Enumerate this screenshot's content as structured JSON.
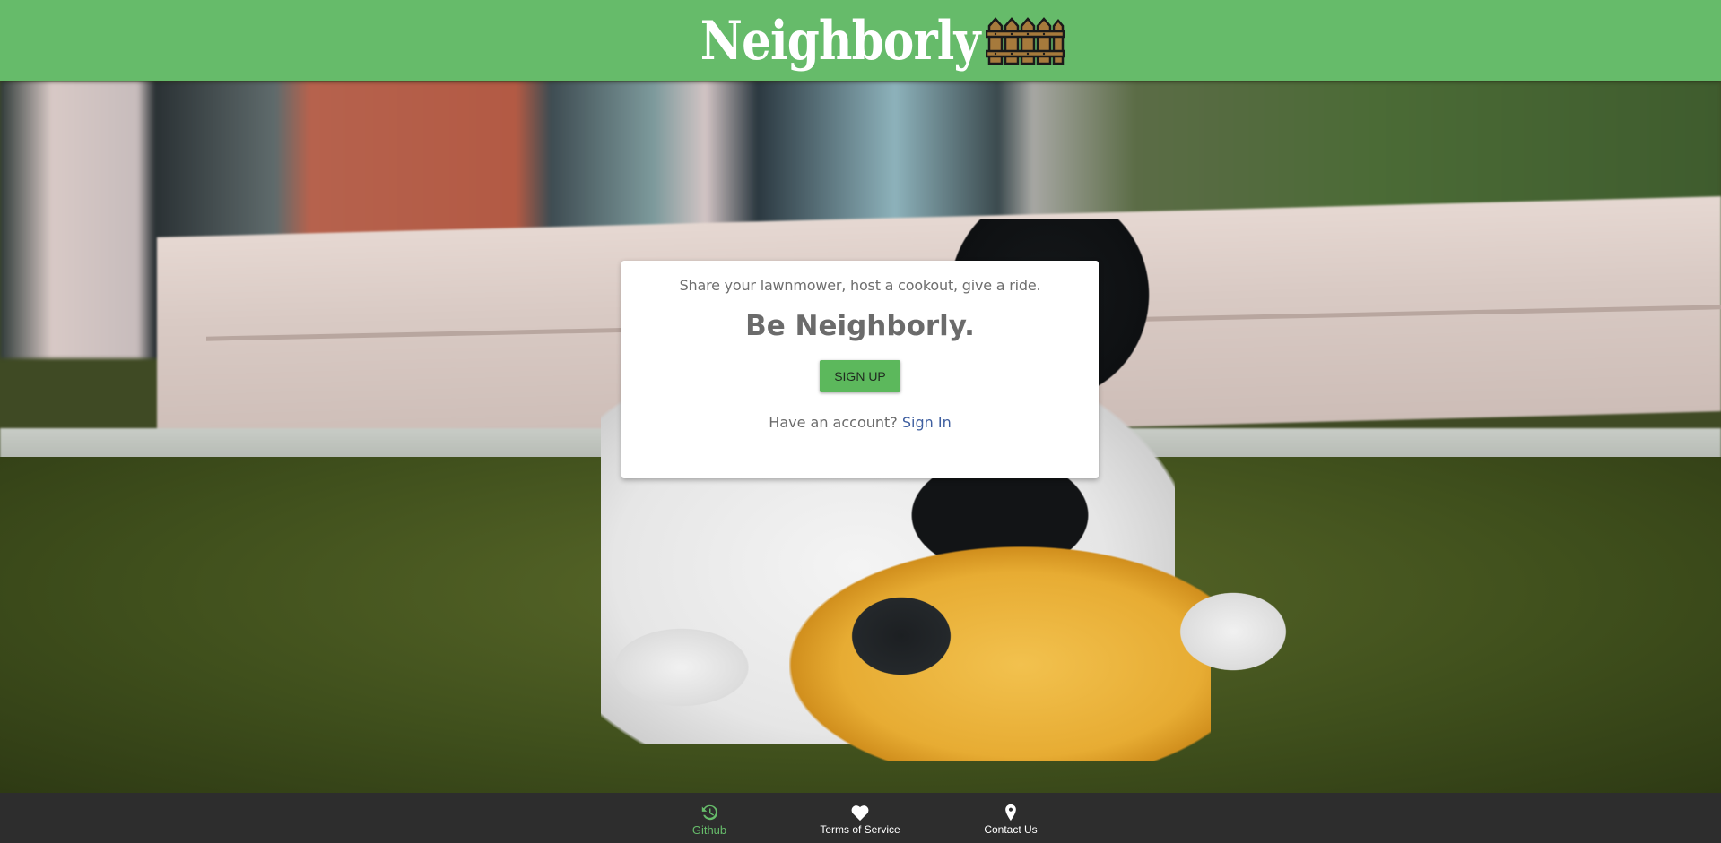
{
  "header": {
    "brand": "Neighborly",
    "logo_icon": "fence-icon",
    "background_color": "#66bb6a"
  },
  "card": {
    "tagline": "Share your lawnmower, host a cookout, give a ride.",
    "headline": "Be Neighborly.",
    "signup_label": "SIGN UP",
    "signin_prompt": "Have an account?",
    "signin_link": "Sign In",
    "button_color": "#5cb85c",
    "link_color": "#3f5fa0"
  },
  "footer": {
    "items": [
      {
        "label": "Github",
        "icon": "history-icon",
        "active": true
      },
      {
        "label": "Terms of Service",
        "icon": "heart-icon",
        "active": false
      },
      {
        "label": "Contact Us",
        "icon": "map-pin-icon",
        "active": false
      }
    ],
    "active_color": "#66bb6a",
    "background_color": "#2d2d2d"
  }
}
